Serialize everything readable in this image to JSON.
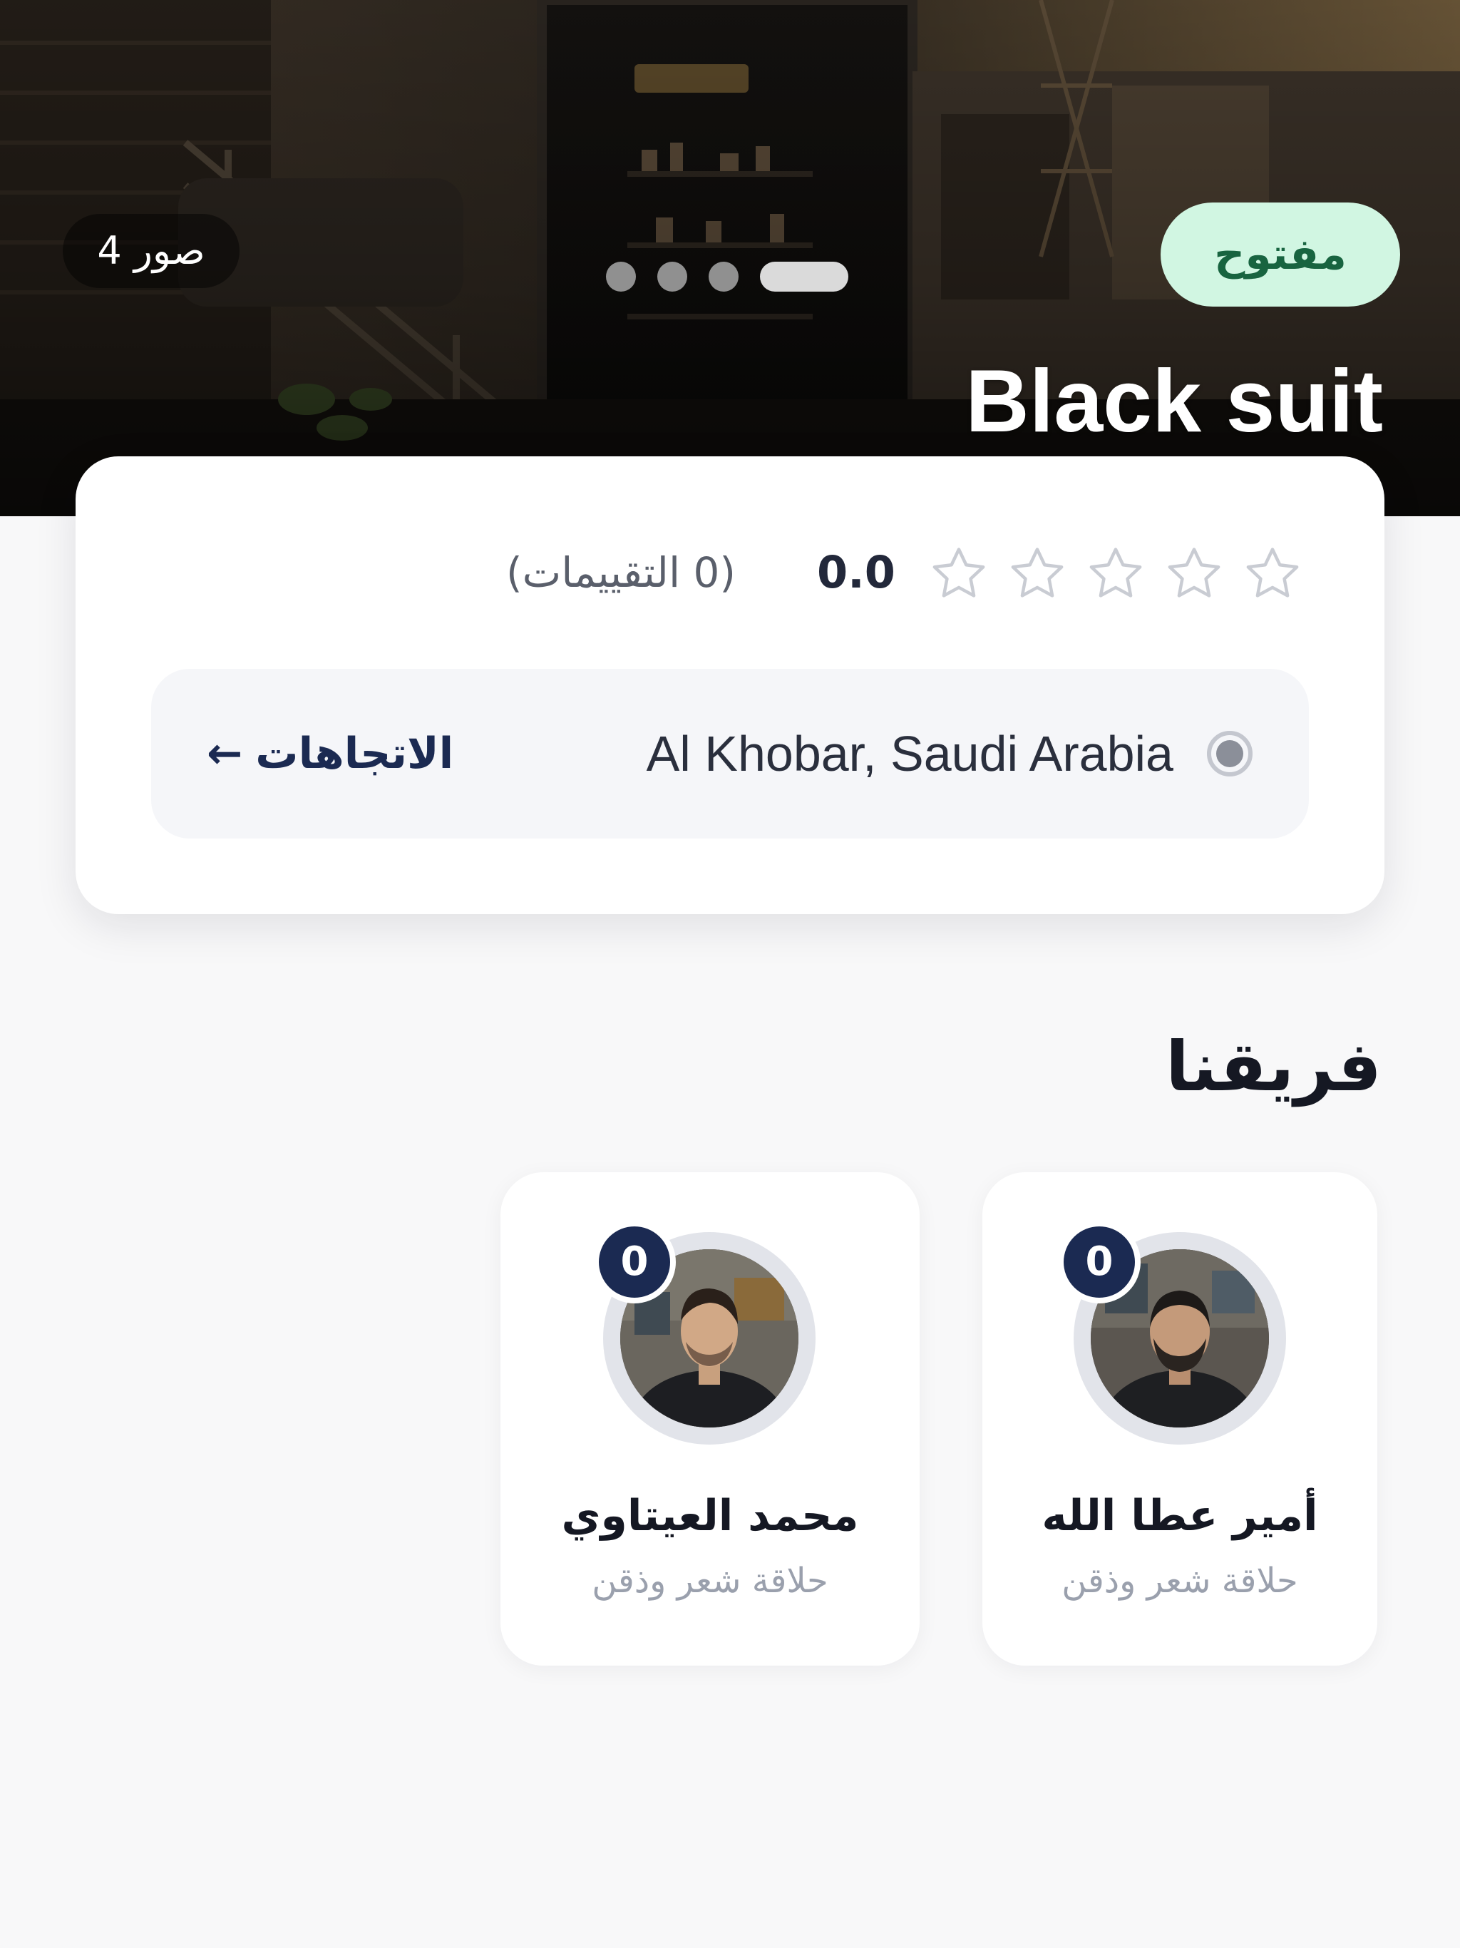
{
  "hero": {
    "photo_count": "4 صور",
    "status": "مفتوح",
    "shop_name": "Black suit",
    "slides": {
      "total": 4,
      "active_index": 3
    }
  },
  "rating": {
    "stars_filled": 0,
    "stars_total": 5,
    "value": "0.0",
    "count_label": "(0 التقييمات)"
  },
  "location": {
    "text": "Al Khobar, Saudi Arabia",
    "directions_label": "الاتجاهات",
    "directions_arrow": "←"
  },
  "team": {
    "title": "فريقنا",
    "members": [
      {
        "name": "أمير عطا الله",
        "role": "حلاقة شعر وذقن",
        "count": "0"
      },
      {
        "name": "محمد العيتاوي",
        "role": "حلاقة شعر وذقن",
        "count": "0"
      }
    ]
  },
  "colors": {
    "status_bg": "#d1f6e2",
    "status_text": "#186440",
    "accent_navy": "#1b2a52",
    "page_bg": "#f8f8f9"
  },
  "icons": {
    "star": "star-outline-icon",
    "location": "location-dot-icon",
    "directions": "arrow-left-icon"
  }
}
